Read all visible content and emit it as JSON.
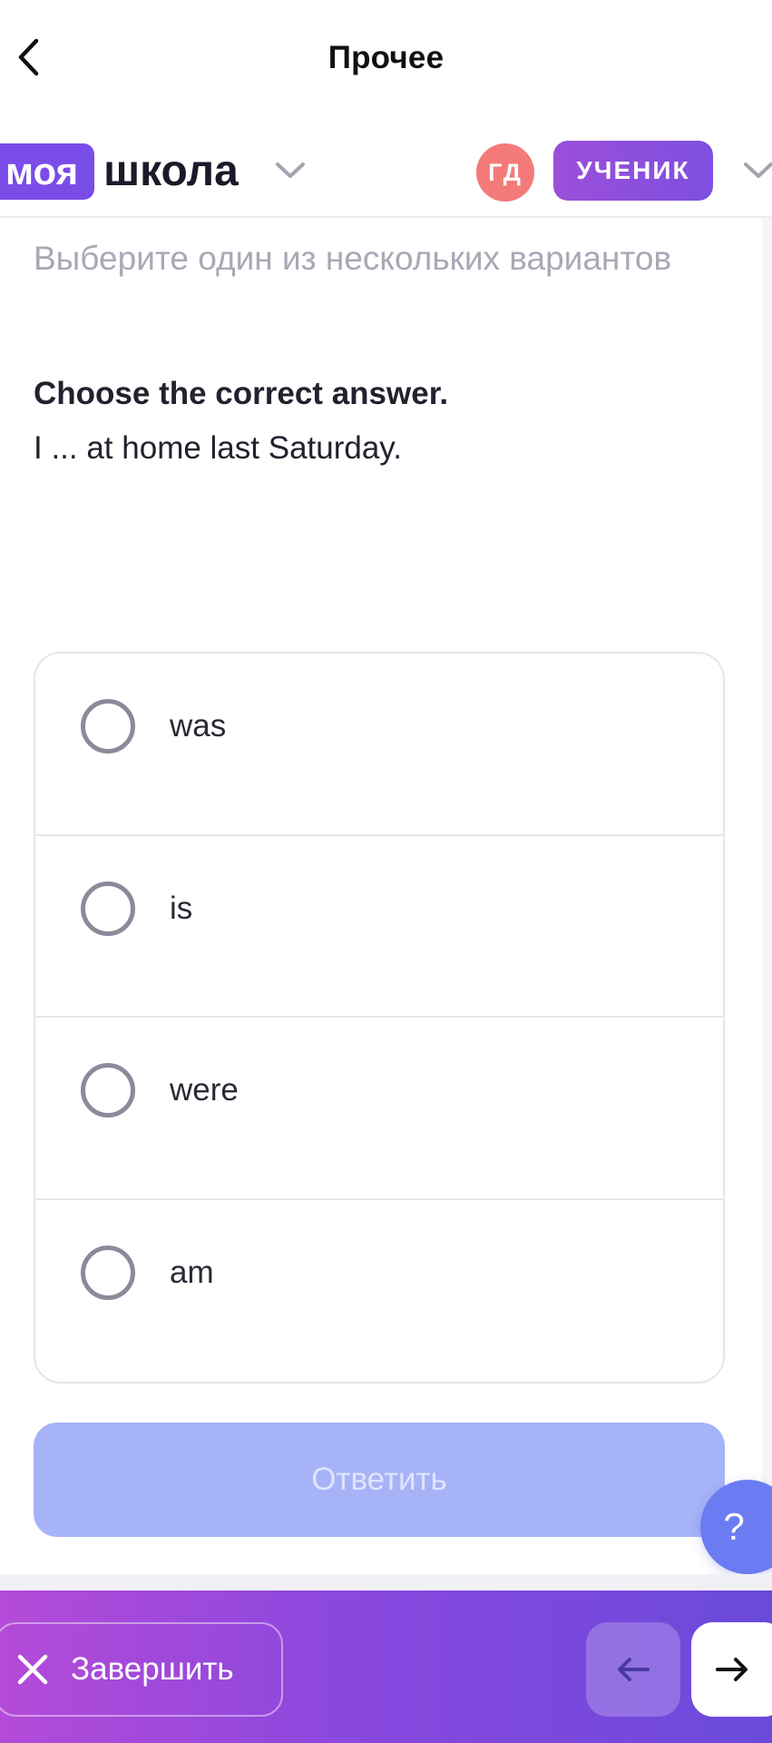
{
  "nav": {
    "title": "Прочее",
    "back_icon": "chevron-left-icon"
  },
  "brand": {
    "part1": "моя",
    "part2": "школа",
    "chevron_icon": "chevron-down-icon"
  },
  "user": {
    "initials": "ГД",
    "role": "УЧЕНИК",
    "avatar_color": "#f47a7a"
  },
  "task": {
    "hint": "Выберите один из нескольких вариантов",
    "title": "Choose the correct answer.",
    "text": "I ... at home last Saturday."
  },
  "options": [
    {
      "label": "was",
      "selected": false
    },
    {
      "label": "is",
      "selected": false
    },
    {
      "label": "were",
      "selected": false
    },
    {
      "label": "am",
      "selected": false
    }
  ],
  "submit": {
    "label": "Ответить",
    "enabled": false,
    "color": "#a6b3f7"
  },
  "help": {
    "label": "?"
  },
  "bottom": {
    "finish_label": "Завершить",
    "prev_icon": "arrow-left-icon",
    "next_icon": "arrow-right-icon"
  },
  "colors": {
    "accent": "#7a4ce8",
    "help": "#6b7bf2"
  }
}
